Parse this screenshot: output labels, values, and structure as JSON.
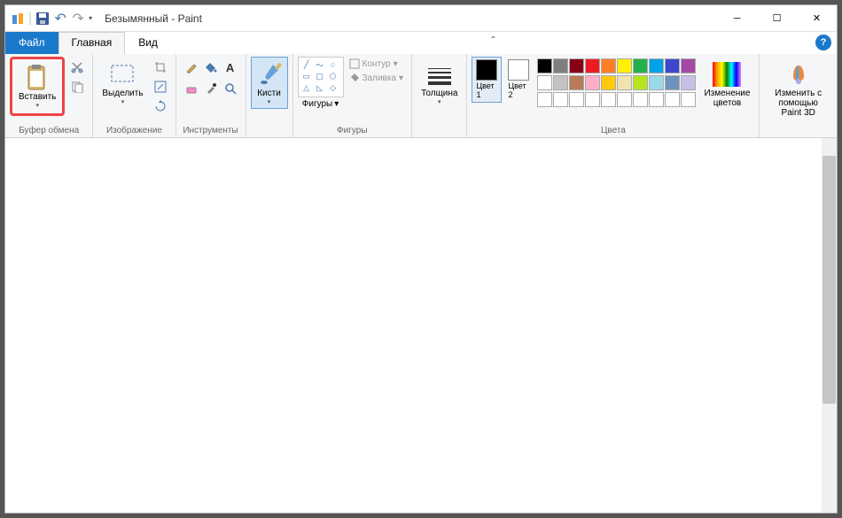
{
  "window": {
    "title": "Безымянный - Paint"
  },
  "tabs": {
    "file": "Файл",
    "home": "Главная",
    "view": "Вид"
  },
  "ribbon": {
    "clipboard": {
      "paste": "Вставить",
      "label": "Буфер обмена"
    },
    "image": {
      "select": "Выделить",
      "label": "Изображение"
    },
    "tools": {
      "label": "Инструменты"
    },
    "brushes": {
      "label": "Кисти"
    },
    "shapes": {
      "shapes": "Фигуры",
      "outline": "Контур",
      "fill": "Заливка",
      "label": "Фигуры"
    },
    "size": {
      "label": "Толщина"
    },
    "colors": {
      "color1": "Цвет 1",
      "color2": "Цвет 2",
      "edit": "Изменение цветов",
      "label": "Цвета",
      "row1": [
        "#000000",
        "#7f7f7f",
        "#880015",
        "#ed1c24",
        "#ff7f27",
        "#fff200",
        "#22b14c",
        "#00a2e8",
        "#3f48cc",
        "#a349a4"
      ],
      "row2": [
        "#ffffff",
        "#c3c3c3",
        "#b97a57",
        "#ffaec9",
        "#ffc90e",
        "#efe4b0",
        "#b5e61d",
        "#99d9ea",
        "#7092be",
        "#c8bfe7"
      ],
      "row3": [
        "#ffffff",
        "#ffffff",
        "#ffffff",
        "#ffffff",
        "#ffffff",
        "#ffffff",
        "#ffffff",
        "#ffffff",
        "#ffffff",
        "#ffffff"
      ]
    },
    "paint3d": {
      "label": "Изменить с помощью Paint 3D"
    }
  }
}
